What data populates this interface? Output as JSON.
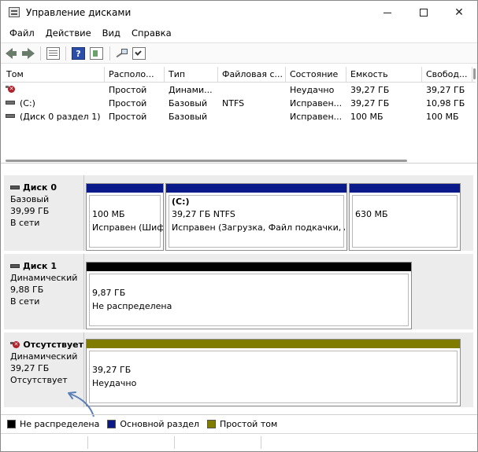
{
  "window": {
    "title": "Управление дисками"
  },
  "menu": [
    "Файл",
    "Действие",
    "Вид",
    "Справка"
  ],
  "volumes": {
    "columns": [
      "Том",
      "Располо...",
      "Тип",
      "Файловая с...",
      "Состояние",
      "Емкость",
      "Свобод..."
    ],
    "rows": [
      {
        "name": "",
        "layout": "Простой",
        "type": "Динами...",
        "fs": "",
        "status": "Неудачно",
        "capacity": "39,27 ГБ",
        "free": "39,27 ГБ",
        "icon": "failed-volume-icon"
      },
      {
        "name": "(C:)",
        "layout": "Простой",
        "type": "Базовый",
        "fs": "NTFS",
        "status": "Исправен...",
        "capacity": "39,27 ГБ",
        "free": "10,98 ГБ",
        "icon": "volume-icon"
      },
      {
        "name": "(Диск 0 раздел 1)",
        "layout": "Простой",
        "type": "Базовый",
        "fs": "",
        "status": "Исправен...",
        "capacity": "100 МБ",
        "free": "100 МБ",
        "icon": "volume-icon"
      }
    ]
  },
  "disks": [
    {
      "name": "Диск 0",
      "type": "Базовый",
      "size": "39,99 ГБ",
      "status": "В сети",
      "partitions": [
        {
          "title": "",
          "line1": "100 МБ",
          "line2": "Исправен (Шиф"
        },
        {
          "title": "(C:)",
          "line1": "39,27 ГБ NTFS",
          "line2": "Исправен (Загрузка, Файл подкачки, Ав"
        },
        {
          "title": "",
          "line1": "630 МБ",
          "line2": ""
        }
      ]
    },
    {
      "name": "Диск 1",
      "type": "Динамический",
      "size": "9,88 ГБ",
      "status": "В сети",
      "partitions": [
        {
          "title": "",
          "line1": "9,87 ГБ",
          "line2": "Не распределена"
        }
      ]
    },
    {
      "name": "Отсутствует",
      "type": "Динамический",
      "size": "39,27 ГБ",
      "status": "Отсутствует",
      "partitions": [
        {
          "title": "",
          "line1": "39,27 ГБ",
          "line2": "Неудачно"
        }
      ]
    }
  ],
  "legend": [
    {
      "label": "Не распределена",
      "color": "#000000"
    },
    {
      "label": "Основной раздел",
      "color": "#0a1a8a"
    },
    {
      "label": "Простой том",
      "color": "#807c00"
    }
  ],
  "colors": {
    "primary": "#0a1a8a",
    "unallocated": "#000000",
    "simple": "#807c00",
    "annotation_arrow": "#5a7fb8"
  }
}
